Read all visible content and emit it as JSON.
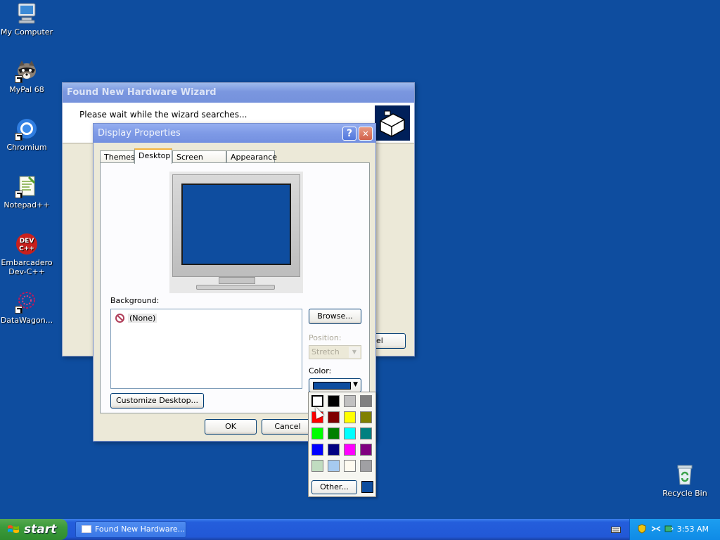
{
  "desktop": {
    "icons": [
      {
        "label": "My Computer"
      },
      {
        "label": "MyPal 68"
      },
      {
        "label": "Chromium"
      },
      {
        "label": "Notepad++"
      },
      {
        "label": "Embarcadero Dev-C++"
      },
      {
        "label": "DataWagon..."
      },
      {
        "label": "Recycle Bin"
      }
    ],
    "background_color": "#0e4d9f"
  },
  "wizard": {
    "title": "Found New Hardware Wizard",
    "message": "Please wait while the wizard searches...",
    "cancel_label": "ncel"
  },
  "display_properties": {
    "title": "Display Properties",
    "help_button": "?",
    "close_button": "✕",
    "tabs": [
      {
        "label": "Themes",
        "selected": false
      },
      {
        "label": "Desktop",
        "selected": true
      },
      {
        "label": "Screen Saver",
        "selected": false
      },
      {
        "label": "Appearance",
        "selected": false
      }
    ],
    "background_label": "Background:",
    "background_items": [
      {
        "label": "(None)",
        "selected": true
      }
    ],
    "browse_label": "Browse...",
    "position_label": "Position:",
    "position_value": "Stretch",
    "color_label": "Color:",
    "customize_label": "Customize Desktop...",
    "ok_label": "OK",
    "cancel_label": "Cancel"
  },
  "color_picker": {
    "swatches": [
      "#ffffff",
      "#000000",
      "#c0c0c0",
      "#808080",
      "#ff0000",
      "#800000",
      "#ffff00",
      "#808000",
      "#00ff00",
      "#008000",
      "#00ffff",
      "#008080",
      "#0000ff",
      "#000080",
      "#ff00ff",
      "#800080",
      "#c0dcc0",
      "#a6caf0",
      "#fffbf0",
      "#a0a0a4"
    ],
    "selected_index": 0,
    "other_label": "Other...",
    "current_color": "#0e4d9f"
  },
  "taskbar": {
    "start_label": "start",
    "tasks": [
      {
        "label": "Found New Hardware..."
      }
    ],
    "clock": "3:53 AM"
  }
}
